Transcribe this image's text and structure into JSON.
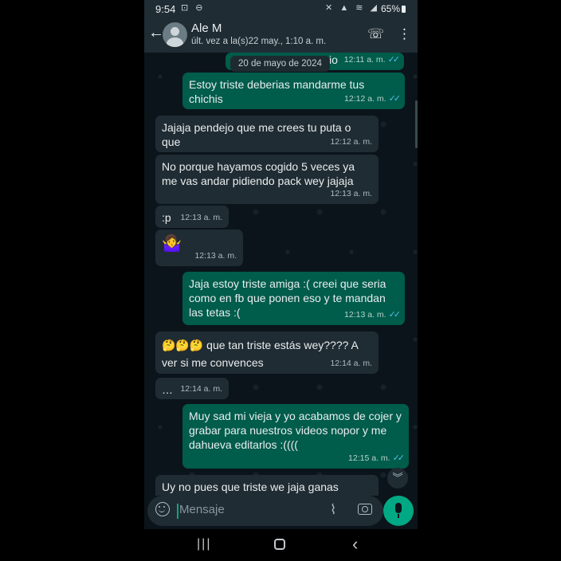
{
  "status_bar": {
    "time": "9:54",
    "left_icons": "⊡ ⊖",
    "right_icons": "✕ ▲ ≋ ◢",
    "battery": "65%"
  },
  "header": {
    "contact_name": "Ale M",
    "last_seen": "últ. vez a la(s)22 may., 1:10 a. m."
  },
  "date_pill": "20 de mayo de 2024",
  "messages": [
    {
      "side": "out",
      "text": "io",
      "time": "12:11 a. m.",
      "ticks": "✓✓"
    },
    {
      "side": "out",
      "text": "Estoy triste deberias mandarme tus chichis",
      "time": "12:12 a. m.",
      "ticks": "✓✓"
    },
    {
      "side": "in",
      "text": "Jajaja pendejo que me crees tu puta o que",
      "time": "12:12 a. m."
    },
    {
      "side": "in",
      "text": "No porque hayamos cogido 5 veces ya me vas andar pidiendo pack wey jajaja",
      "time": "12:13 a. m."
    },
    {
      "side": "in",
      "text": ":p",
      "time": "12:13 a. m."
    },
    {
      "side": "in",
      "text": "🤷‍♀️",
      "time": "12:13 a. m."
    },
    {
      "side": "out",
      "text": "Jaja estoy triste amiga :( creei que seria como en fb que ponen eso y te mandan las tetas :(",
      "time": "12:13 a. m.",
      "ticks": "✓✓"
    },
    {
      "side": "in",
      "text": "🤔🤔🤔 que tan triste estás wey???? A ver si me convences",
      "time": "12:14 a. m."
    },
    {
      "side": "in",
      "text": "…",
      "time": "12:14 a. m."
    },
    {
      "side": "out",
      "text": "Muy sad mi vieja y yo acabamos de cojer y grabar para nuestros videos nopor y me dahueva editarlos :((((",
      "time": "12:15 a. m.",
      "ticks": "✓✓"
    },
    {
      "side": "in",
      "text": "Uy no pues que triste we jaja ganas",
      "time": ""
    }
  ],
  "composer": {
    "placeholder": "Mensaje"
  },
  "icons": {
    "back": "back-arrow-icon",
    "call_add": "add-call-icon",
    "more": "more-options-icon",
    "emoji": "emoji-icon",
    "attach": "paperclip-icon",
    "camera": "camera-icon",
    "mic": "microphone-icon",
    "scroll_down": "double-chevron-down-icon"
  },
  "colors": {
    "outgoing_bubble": "#005c4b",
    "incoming_bubble": "#202c33",
    "accent": "#00a884",
    "read_ticks": "#53bdeb"
  }
}
